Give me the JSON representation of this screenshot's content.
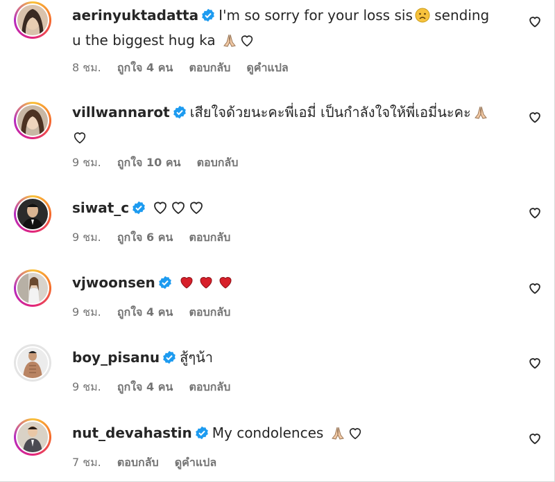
{
  "comments": [
    {
      "username": "aerinyuktadatta",
      "text": "I'm so sorry for your loss sis",
      "text_after": " sending u the biggest hug ka ",
      "time": "8 ชม.",
      "likes": "ถูกใจ 4 คน",
      "reply": "ตอบกลับ",
      "translate": "ดูคำแปล",
      "emojis": [
        "sad-face",
        "praying-hands",
        "white-heart"
      ]
    },
    {
      "username": "villwannarot",
      "text": "เสียใจด้วยนะคะพี่เอมี่ เป็นกำลังใจให้พี่เอมี่นะคะ",
      "time": "9 ชม.",
      "likes": "ถูกใจ 10 คน",
      "reply": "ตอบกลับ",
      "emojis": [
        "praying-hands",
        "white-heart"
      ]
    },
    {
      "username": "siwat_c",
      "text": "",
      "time": "9 ชม.",
      "likes": "ถูกใจ 6 คน",
      "reply": "ตอบกลับ",
      "emojis": [
        "white-heart",
        "white-heart",
        "white-heart"
      ]
    },
    {
      "username": "vjwoonsen",
      "text": "",
      "time": "9 ชม.",
      "likes": "ถูกใจ 4 คน",
      "reply": "ตอบกลับ",
      "emojis": [
        "red-heart",
        "red-heart",
        "red-heart"
      ]
    },
    {
      "username": "boy_pisanu",
      "text": "สู้ๆน้า",
      "time": "9 ชม.",
      "likes": "ถูกใจ 4 คน",
      "reply": "ตอบกลับ",
      "emojis": []
    },
    {
      "username": "nut_devahastin",
      "text": "My condolences ",
      "time": "7 ชม.",
      "reply": "ตอบกลับ",
      "translate": "ดูคำแปล",
      "emojis": [
        "praying-hands",
        "white-heart"
      ]
    }
  ],
  "colors": {
    "verified": "#1d9bf0",
    "meta_text": "#737373",
    "story_ring": "#e0237e",
    "red_heart": "#d7202a"
  }
}
